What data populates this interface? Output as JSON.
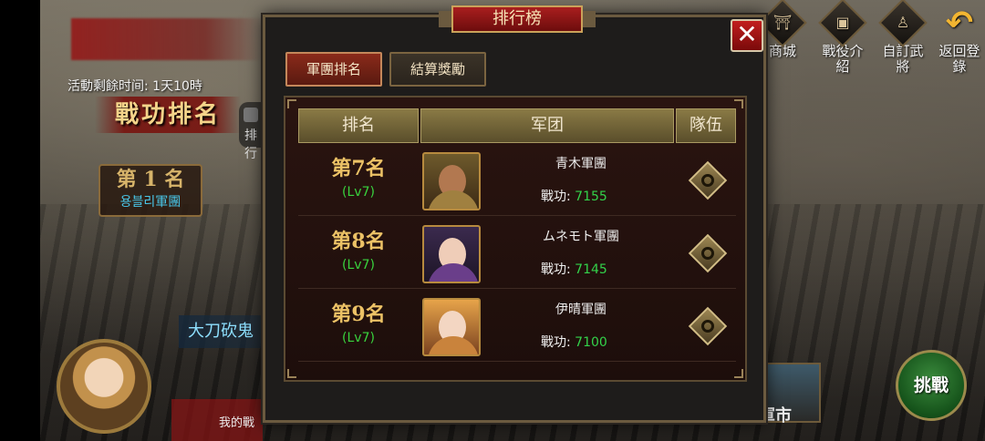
{
  "event": {
    "timer_text": "活動剩餘时间: 1天10時",
    "title": "戰功排名",
    "rank_tab_partial": "排行",
    "first_place_rank": "第 1 名",
    "first_place_name": "용블리軍團",
    "general_label": "大刀砍鬼",
    "my_battle_text": "我的戰"
  },
  "side_menu": {
    "shop": "商城",
    "battle_intro": "戰役介紹",
    "general_tailor": "自訂武將",
    "return": "返回登錄",
    "market": "軍市",
    "challenge": "挑戰"
  },
  "modal": {
    "title": "排行榜",
    "close": "✕",
    "tabs": [
      {
        "label": "軍團排名",
        "active": true
      },
      {
        "label": "結算獎勵",
        "active": false
      }
    ],
    "headers": {
      "rank": "排名",
      "legion": "军团",
      "team": "隊伍"
    },
    "rows": [
      {
        "rank": "第7名",
        "level": "(Lv7)",
        "legion_name": "青木軍團",
        "merit_label": "戰功:",
        "merit_value": "7155"
      },
      {
        "rank": "第8名",
        "level": "(Lv7)",
        "legion_name": "ムネモト軍團",
        "merit_label": "戰功:",
        "merit_value": "7145"
      },
      {
        "rank": "第9名",
        "level": "(Lv7)",
        "legion_name": "伊晴軍團",
        "merit_label": "戰功:",
        "merit_value": "7100"
      }
    ]
  },
  "colors": {
    "accent_gold": "#ecc266",
    "merit_green": "#33d24a",
    "level_green": "#39d23d",
    "title_red": "#a91e1e"
  },
  "icons": [
    "shop-icon",
    "battle-intro-icon",
    "general-icon",
    "return-icon",
    "magnifier-icon",
    "close-icon"
  ]
}
